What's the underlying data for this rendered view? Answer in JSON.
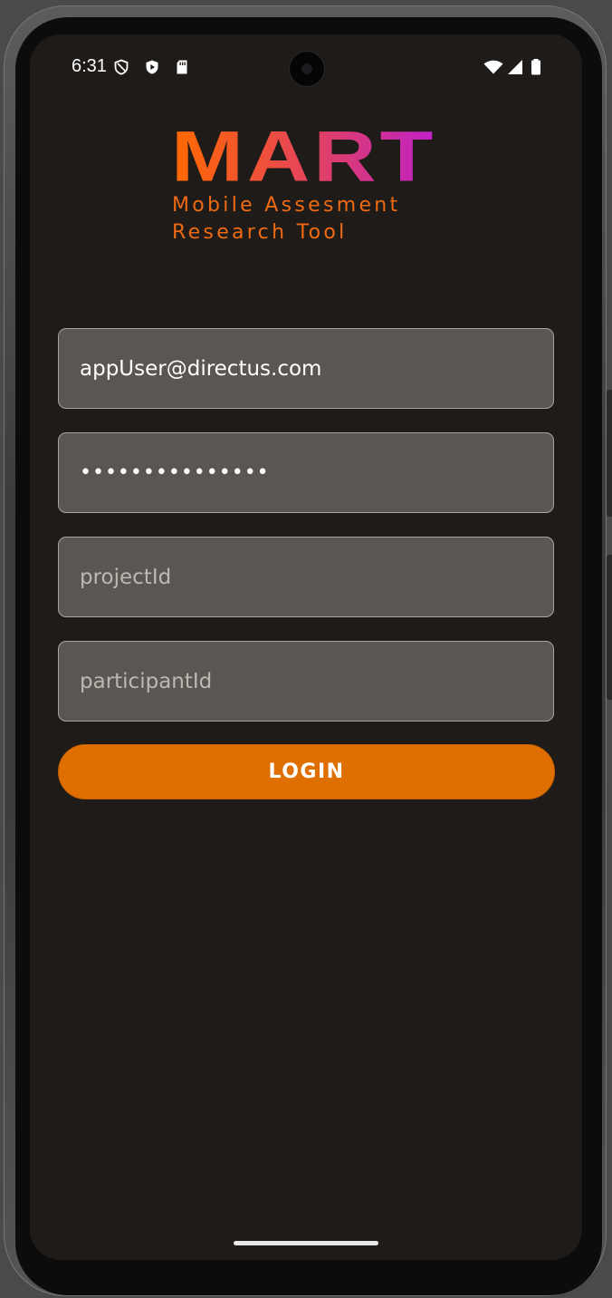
{
  "status_bar": {
    "time": "6:31",
    "left_icons": [
      "shield-outline-icon",
      "shield-play-icon",
      "sd-card-icon"
    ],
    "right_icons": [
      "wifi-icon",
      "signal-icon",
      "battery-icon"
    ]
  },
  "logo": {
    "title": "MART",
    "subtitle_line1": "Mobile Assesment",
    "subtitle_line2": "Research Tool",
    "gradient_colors": [
      "#ff6a00",
      "#c020c8"
    ],
    "subtitle_color": "#ef6a12"
  },
  "form": {
    "email": {
      "value": "appUser@directus.com",
      "placeholder": ""
    },
    "password": {
      "value": "•••••••••••••••",
      "placeholder": ""
    },
    "project_id": {
      "value": "",
      "placeholder": "projectId"
    },
    "participant_id": {
      "value": "",
      "placeholder": "participantId"
    },
    "login_label": "LOGIN"
  },
  "colors": {
    "background": "#1e1b18",
    "field_background": "#5a5652",
    "field_border": "#a9a49c",
    "button": "#df6f00"
  }
}
